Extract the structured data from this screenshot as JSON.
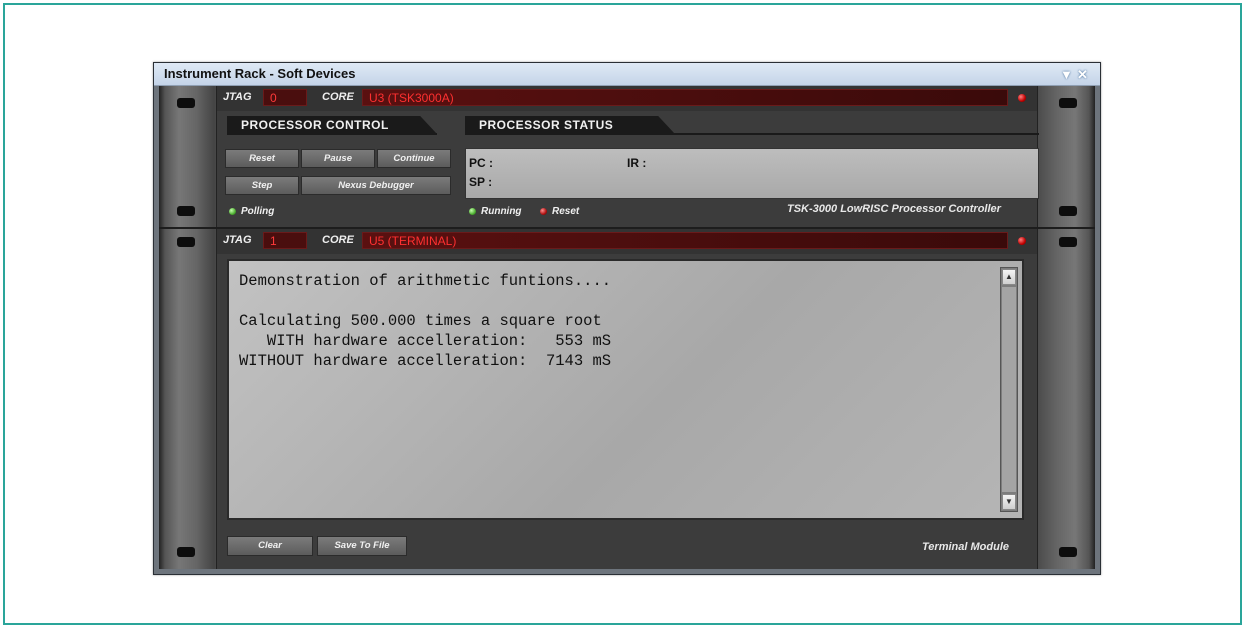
{
  "window": {
    "title": "Instrument Rack - Soft Devices",
    "dropdown_icon": "▼",
    "close_icon": "✕"
  },
  "processor": {
    "jtag_label": "JTAG",
    "jtag_value": "0",
    "core_label": "CORE",
    "core_value": "U3 (TSK3000A)",
    "control_tab": "PROCESSOR CONTROL",
    "status_tab": "PROCESSOR STATUS",
    "buttons": {
      "reset": "Reset",
      "pause": "Pause",
      "continue": "Continue",
      "step": "Step",
      "nexus": "Nexus Debugger"
    },
    "status": {
      "pc_label": "PC :",
      "ir_label": "IR :",
      "sp_label": "SP :"
    },
    "leds": {
      "polling": "Polling",
      "running": "Running",
      "reset": "Reset"
    },
    "module_name": "TSK-3000 LowRISC Processor Controller"
  },
  "terminal": {
    "jtag_label": "JTAG",
    "jtag_value": "1",
    "core_label": "CORE",
    "core_value": "U5 (TERMINAL)",
    "output": "Demonstration of arithmetic funtions....\n\nCalculating 500.000 times a square root\n   WITH hardware accelleration:   553 mS\nWITHOUT hardware accelleration:  7143 mS",
    "buttons": {
      "clear": "Clear",
      "save": "Save To File"
    },
    "module_name": "Terminal Module"
  },
  "colors": {
    "frame_border": "#2aa59a",
    "led_green": "#4caf30",
    "led_red": "#c00000",
    "core_text": "#ff3030"
  }
}
